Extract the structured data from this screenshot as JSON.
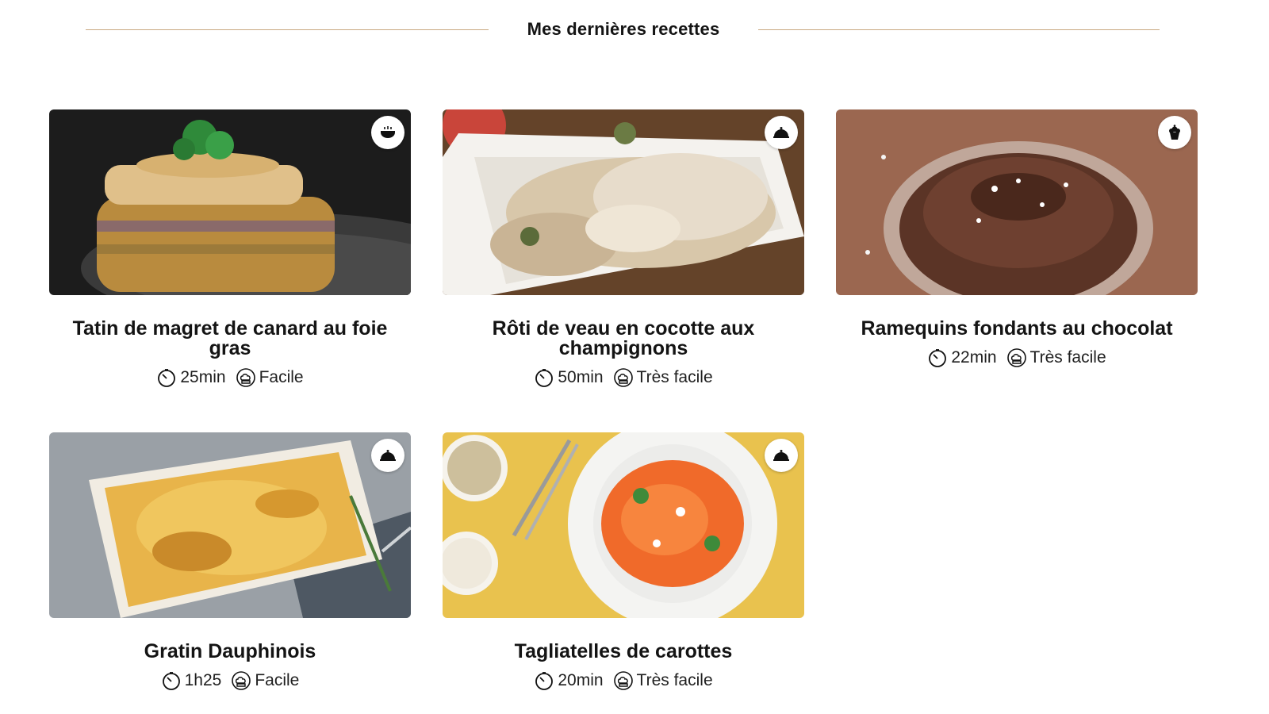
{
  "section": {
    "title": "Mes dernières recettes"
  },
  "recipes": [
    {
      "title": "Tatin de magret de canard au foie gras",
      "time": "25min",
      "difficulty": "Facile",
      "category_icon": "soup-bowl-icon",
      "image_description_colors": [
        "#1e1e1e",
        "#c8a25a"
      ]
    },
    {
      "title": "Rôti de veau en cocotte aux champignons",
      "time": "50min",
      "difficulty": "Très facile",
      "category_icon": "cloche-icon",
      "image_description_colors": [
        "#6b4a2e",
        "#f2efe9"
      ]
    },
    {
      "title": "Ramequins fondants au chocolat",
      "time": "22min",
      "difficulty": "Très facile",
      "category_icon": "cupcake-icon",
      "image_description_colors": [
        "#8a5a43",
        "#5a3426"
      ]
    },
    {
      "title": "Gratin Dauphinois",
      "time": "1h25",
      "difficulty": "Facile",
      "category_icon": "cloche-icon",
      "image_description_colors": [
        "#9aa0a6",
        "#e8b44a"
      ]
    },
    {
      "title": "Tagliatelles de carottes",
      "time": "20min",
      "difficulty": "Très facile",
      "category_icon": "cloche-icon",
      "image_description_colors": [
        "#e9c24e",
        "#f06a2a"
      ]
    }
  ],
  "colors": {
    "accent_line": "#c9a982",
    "text": "#141414"
  }
}
